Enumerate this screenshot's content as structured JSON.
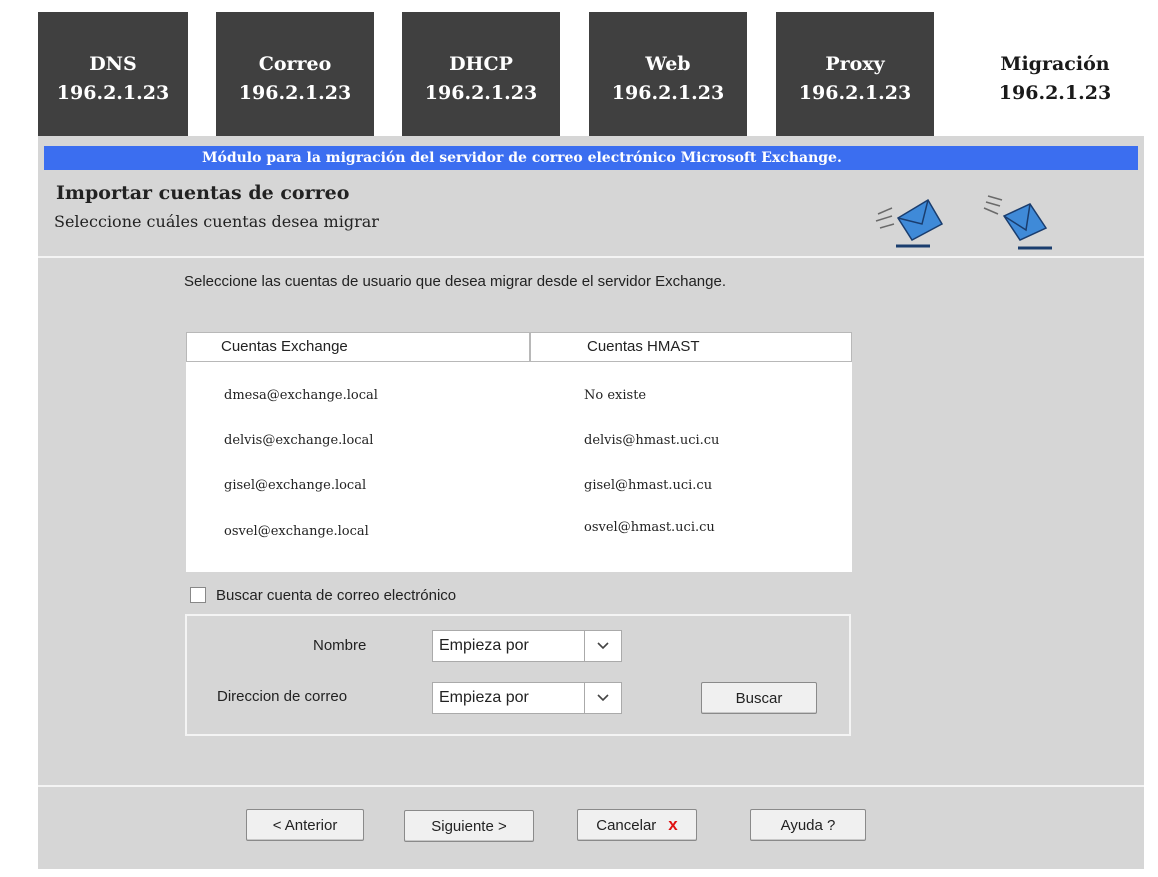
{
  "tabs": [
    {
      "name": "DNS",
      "ip": "196.2.1.23"
    },
    {
      "name": "Correo",
      "ip": "196.2.1.23"
    },
    {
      "name": "DHCP",
      "ip": "196.2.1.23"
    },
    {
      "name": "Web",
      "ip": "196.2.1.23"
    },
    {
      "name": "Proxy",
      "ip": "196.2.1.23"
    },
    {
      "name": "Migración",
      "ip": "196.2.1.23"
    }
  ],
  "banner": "Módulo para la migración del servidor de correo electrónico Microsoft Exchange.",
  "header": {
    "title": "Importar cuentas de correo",
    "subtitle": "Seleccione cuáles cuentas desea migrar"
  },
  "instruction": "Seleccione las cuentas de usuario que desea migrar desde el servidor Exchange.",
  "table": {
    "columns": [
      "Cuentas Exchange",
      "Cuentas HMAST"
    ],
    "rows": [
      [
        "dmesa@exchange.local",
        "No existe"
      ],
      [
        "delvis@exchange.local",
        "delvis@hmast.uci.cu"
      ],
      [
        "gisel@exchange.local",
        "gisel@hmast.uci.cu"
      ],
      [
        "osvel@exchange.local",
        "osvel@hmast.uci.cu"
      ]
    ]
  },
  "search": {
    "checkbox_label": "Buscar cuenta de correo electrónico",
    "name_label": "Nombre",
    "name_select": "Empieza por",
    "email_label": "Direccion de correo",
    "email_select": "Empieza por",
    "button": "Buscar"
  },
  "footer": {
    "prev": "< Anterior",
    "next": "Siguiente >",
    "cancel": "Cancelar",
    "cancel_icon": "x",
    "help": "Ayuda ?"
  },
  "colors": {
    "tab_dark": "#404040",
    "banner_blue": "#3b6ef0",
    "panel_gray": "#d6d6d6",
    "envelope_blue": "#3f8ad8",
    "cancel_red": "#e01010"
  }
}
